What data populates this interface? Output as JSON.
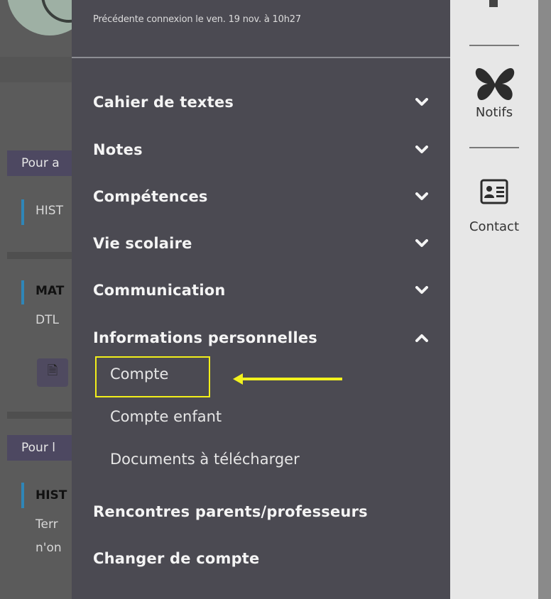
{
  "drawer": {
    "last_login": "Précédente connexion le ven. 19 nov. à 10h27",
    "menu": [
      {
        "label": "Cahier de textes",
        "expanded": false
      },
      {
        "label": "Notes",
        "expanded": false
      },
      {
        "label": "Compétences",
        "expanded": false
      },
      {
        "label": "Vie scolaire",
        "expanded": false
      },
      {
        "label": "Communication",
        "expanded": false
      },
      {
        "label": "Informations personnelles",
        "expanded": true
      }
    ],
    "submenu": [
      "Compte",
      "Compte enfant",
      "Documents à télécharger"
    ],
    "bottom_items": [
      "Rencontres parents/professeurs",
      "Changer de compte"
    ]
  },
  "rail": {
    "notifs_label": "Notifs",
    "contact_label": "Contact"
  },
  "background": {
    "tag1": "Pour a",
    "tag2": "Pour l",
    "line_hist": "HIST",
    "line_mat": "MAT",
    "line_dtl": "DTL",
    "line_hist2": "HIST",
    "line_term": "Terr",
    "line_non": "n'on"
  },
  "colors": {
    "drawer_bg": "#4b4a52",
    "highlight": "#f2ef1a",
    "arrow": "#f2f21e"
  }
}
